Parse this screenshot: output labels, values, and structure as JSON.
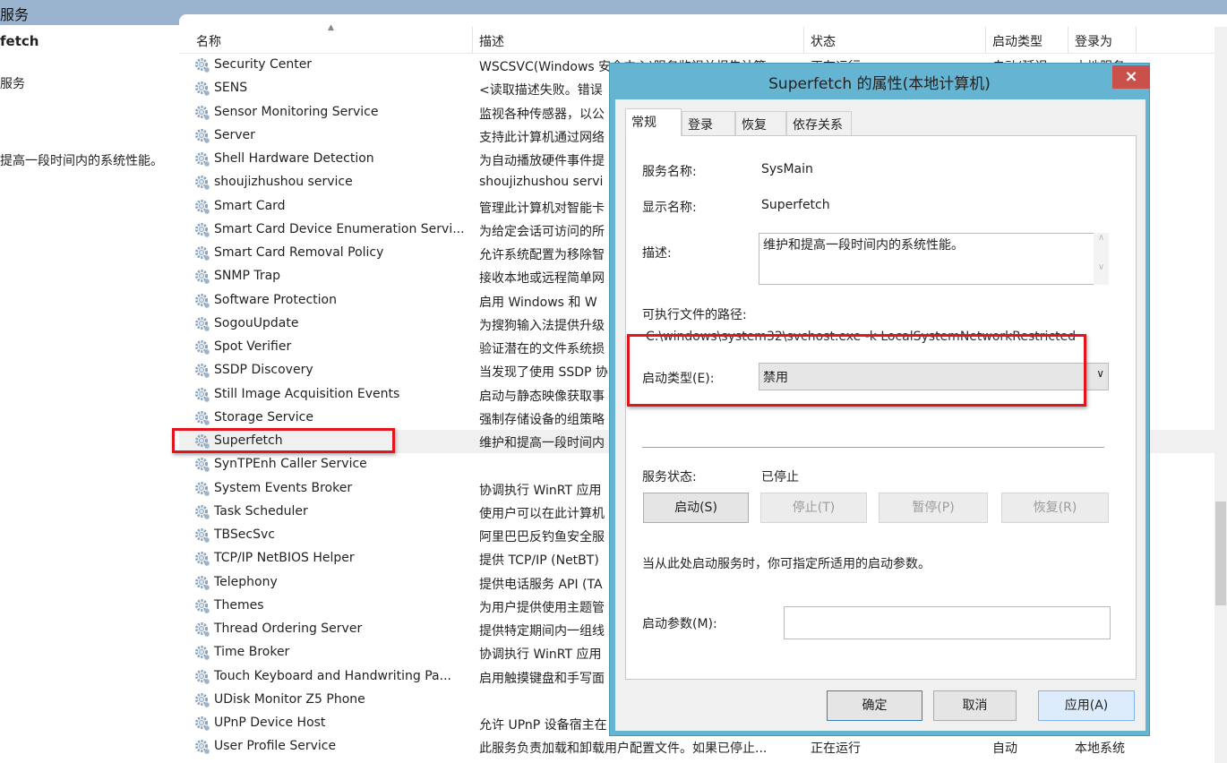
{
  "window": {
    "title_fragment": "服务"
  },
  "left_pane": {
    "service_name_fragment": "fetch",
    "link_fragment": "服务",
    "description_fragment": "提高一段时间内的系统性能。"
  },
  "columns": {
    "name": "名称",
    "description": "描述",
    "status": "状态",
    "startup_type": "启动类型",
    "logon_as": "登录为"
  },
  "services": [
    {
      "name": "Security Center",
      "description": "WSCSVC(Windows 安全中心)服务监视并报告计算",
      "status": "正在运行",
      "startup": "自动(延迟",
      "logon": "本地服务"
    },
    {
      "name": "SENS",
      "description": "<读取描述失败。错误"
    },
    {
      "name": "Sensor Monitoring Service",
      "description": "监视各种传感器，以公"
    },
    {
      "name": "Server",
      "description": "支持此计算机通过网络"
    },
    {
      "name": "Shell Hardware Detection",
      "description": "为自动播放硬件事件提"
    },
    {
      "name": "shoujizhushou service",
      "description": "shoujizhushou servi"
    },
    {
      "name": "Smart Card",
      "description": "管理此计算机对智能卡"
    },
    {
      "name": "Smart Card Device Enumeration Servi...",
      "description": "为给定会话可访问的所"
    },
    {
      "name": "Smart Card Removal Policy",
      "description": "允许系统配置为移除智"
    },
    {
      "name": "SNMP Trap",
      "description": "接收本地或远程简单网"
    },
    {
      "name": "Software Protection",
      "description": "启用 Windows 和 W"
    },
    {
      "name": "SogouUpdate",
      "description": "为搜狗输入法提供升级"
    },
    {
      "name": "Spot Verifier",
      "description": "验证潜在的文件系统损"
    },
    {
      "name": "SSDP Discovery",
      "description": "当发现了使用 SSDP 协"
    },
    {
      "name": "Still Image Acquisition Events",
      "description": "启动与静态映像获取事"
    },
    {
      "name": "Storage Service",
      "description": "强制存储设备的组策略"
    },
    {
      "name": "Superfetch",
      "description": "维护和提高一段时间内",
      "selected": true
    },
    {
      "name": "SynTPEnh Caller Service",
      "description": ""
    },
    {
      "name": "System Events Broker",
      "description": "协调执行 WinRT 应用"
    },
    {
      "name": "Task Scheduler",
      "description": "使用户可以在此计算机"
    },
    {
      "name": "TBSecSvc",
      "description": "阿里巴巴反钓鱼安全服"
    },
    {
      "name": "TCP/IP NetBIOS Helper",
      "description": "提供 TCP/IP (NetBT)"
    },
    {
      "name": "Telephony",
      "description": "提供电话服务 API (TA"
    },
    {
      "name": "Themes",
      "description": "为用户提供使用主题管"
    },
    {
      "name": "Thread Ordering Server",
      "description": "提供特定期间内一组线"
    },
    {
      "name": "Time Broker",
      "description": "协调执行 WinRT 应用"
    },
    {
      "name": "Touch Keyboard and Handwriting Pa...",
      "description": "启用触摸键盘和手写面"
    },
    {
      "name": "UDisk Monitor Z5 Phone",
      "description": ""
    },
    {
      "name": "UPnP Device Host",
      "description": "允许 UPnP 设备宿主在"
    },
    {
      "name": "User Profile Service",
      "description": "此服务负责加载和卸载用户配置文件。如果已停止...",
      "status": "正在运行",
      "startup": "自动",
      "logon": "本地系统"
    }
  ],
  "dialog": {
    "title": "Superfetch 的属性(本地计算机)",
    "close": "×",
    "tabs": [
      "常规",
      "登录",
      "恢复",
      "依存关系"
    ],
    "service_name_label": "服务名称:",
    "service_name": "SysMain",
    "display_name_label": "显示名称:",
    "display_name": "Superfetch",
    "description_label": "描述:",
    "description": "维护和提高一段时间内的系统性能。",
    "path_label": "可执行文件的路径:",
    "path": "C:\\windows\\system32\\svchost.exe -k LocalSystemNetworkRestricted",
    "startup_type_label": "启动类型(E):",
    "startup_type": "禁用",
    "status_label": "服务状态:",
    "status": "已停止",
    "start": "启动(S)",
    "stop": "停止(T)",
    "pause": "暂停(P)",
    "resume": "恢复(R)",
    "hint": "当从此处启动服务时，你可指定所适用的启动参数。",
    "params_label": "启动参数(M):",
    "params": "",
    "ok": "确定",
    "cancel": "取消",
    "apply": "应用(A)"
  },
  "colors": {
    "highlight": "#e2141c",
    "dialog_frame": "#65b4d1",
    "close": "#c9504b",
    "header_band": "#9ab3cf"
  }
}
